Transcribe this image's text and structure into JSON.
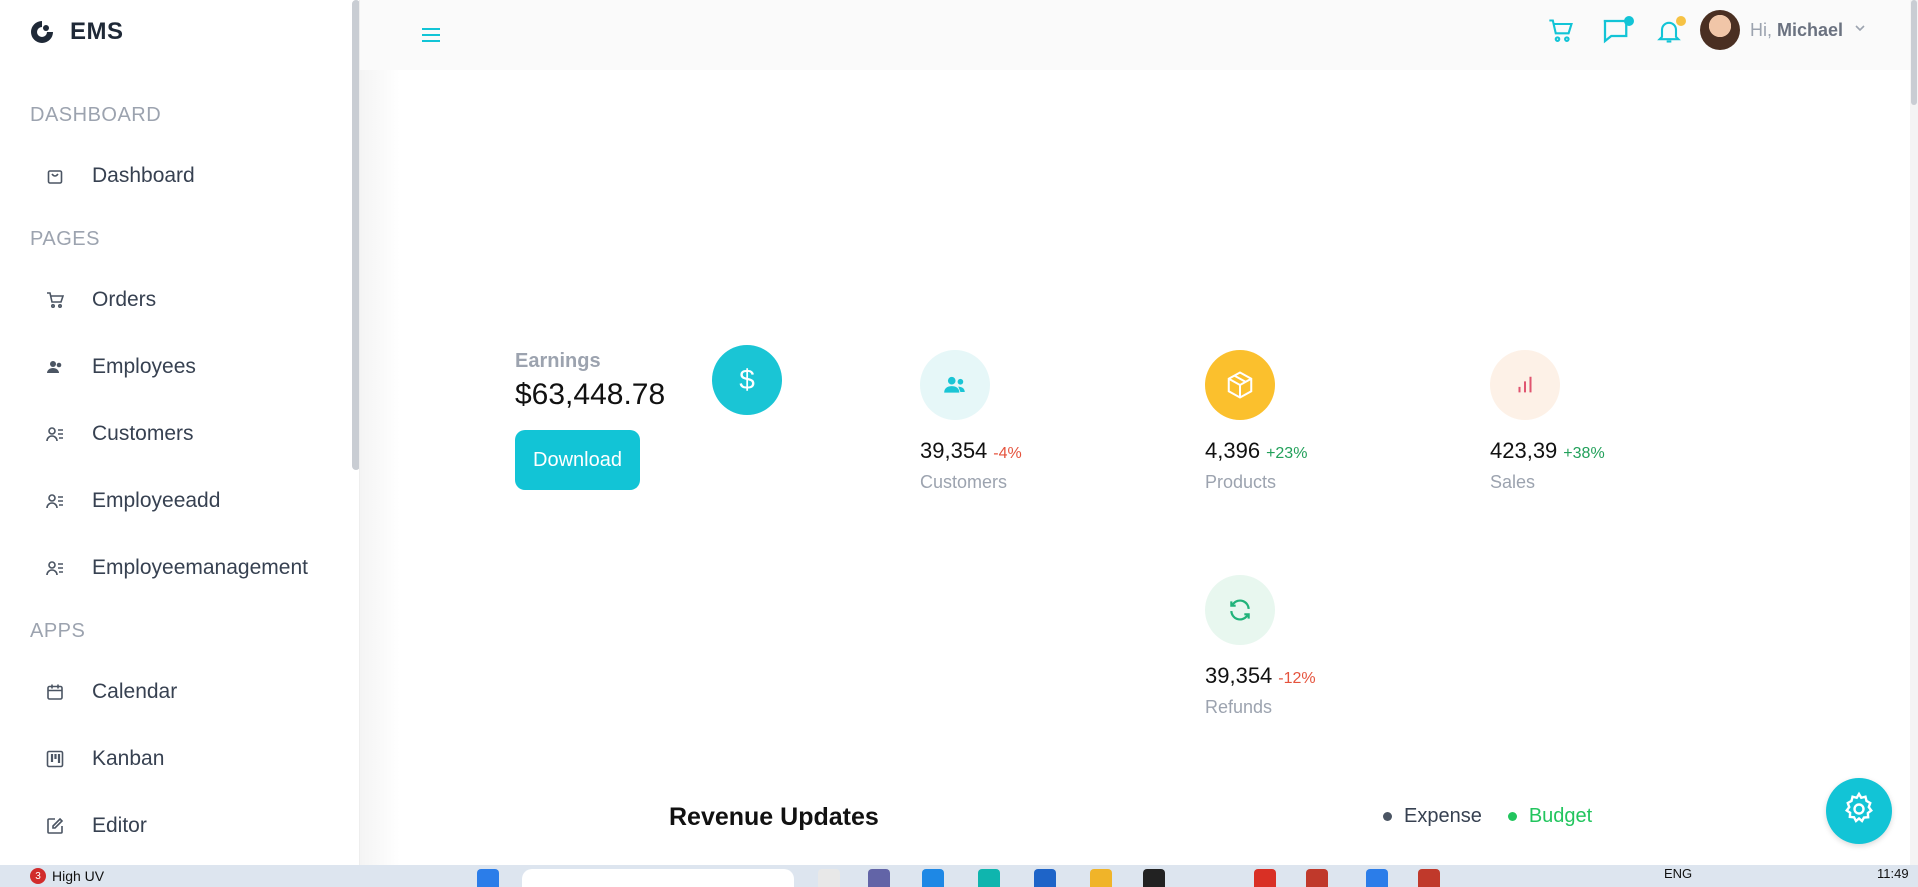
{
  "app": {
    "brand": "EMS"
  },
  "sidebar": {
    "sections": [
      {
        "title": "DASHBOARD"
      },
      {
        "title": "PAGES"
      },
      {
        "title": "APPS"
      }
    ],
    "items": [
      {
        "label": "Dashboard",
        "icon": "shopping-bag-icon"
      },
      {
        "label": "Orders",
        "icon": "cart-icon"
      },
      {
        "label": "Employees",
        "icon": "people-icon"
      },
      {
        "label": "Customers",
        "icon": "user-list-icon"
      },
      {
        "label": "Employeeadd",
        "icon": "user-list-icon"
      },
      {
        "label": "Employeemanagement",
        "icon": "user-list-icon"
      },
      {
        "label": "Calendar",
        "icon": "calendar-icon"
      },
      {
        "label": "Kanban",
        "icon": "kanban-icon"
      },
      {
        "label": "Editor",
        "icon": "edit-icon"
      }
    ]
  },
  "topbar": {
    "greeting": "Hi,",
    "user_name": "Michael",
    "accent": "#12c4d6",
    "notification_dot": "#f6c244"
  },
  "earnings": {
    "label": "Earnings",
    "value": "$63,448.78",
    "icon_symbol": "$",
    "button": "Download"
  },
  "stats": [
    {
      "value": "39,354",
      "change": "-4%",
      "label": "Customers",
      "icon": "users-icon",
      "circle_bg": "#e6f7f8",
      "icon_color": "#1ac5d5",
      "change_color": "#e5533d"
    },
    {
      "value": "4,396",
      "change": "+23%",
      "label": "Products",
      "icon": "box-icon",
      "circle_bg": "#fbc02d",
      "icon_color": "#ffffff",
      "change_color": "#22a05a"
    },
    {
      "value": "423,39",
      "change": "+38%",
      "label": "Sales",
      "icon": "bar-chart-icon",
      "circle_bg": "#fdf1e7",
      "icon_color": "#e05570",
      "change_color": "#22a05a"
    },
    {
      "value": "39,354",
      "change": "-12%",
      "label": "Refunds",
      "icon": "refresh-icon",
      "circle_bg": "#e8f7ef",
      "icon_color": "#21b37a",
      "change_color": "#e5533d"
    }
  ],
  "revenue": {
    "title": "Revenue Updates",
    "legend": [
      {
        "label": "Expense",
        "color": "#4b5563"
      },
      {
        "label": "Budget",
        "color": "#22c55e"
      }
    ]
  },
  "taskbar": {
    "weather_badge": "3",
    "weather_text": "High UV",
    "language": "ENG",
    "time": "11:49"
  }
}
